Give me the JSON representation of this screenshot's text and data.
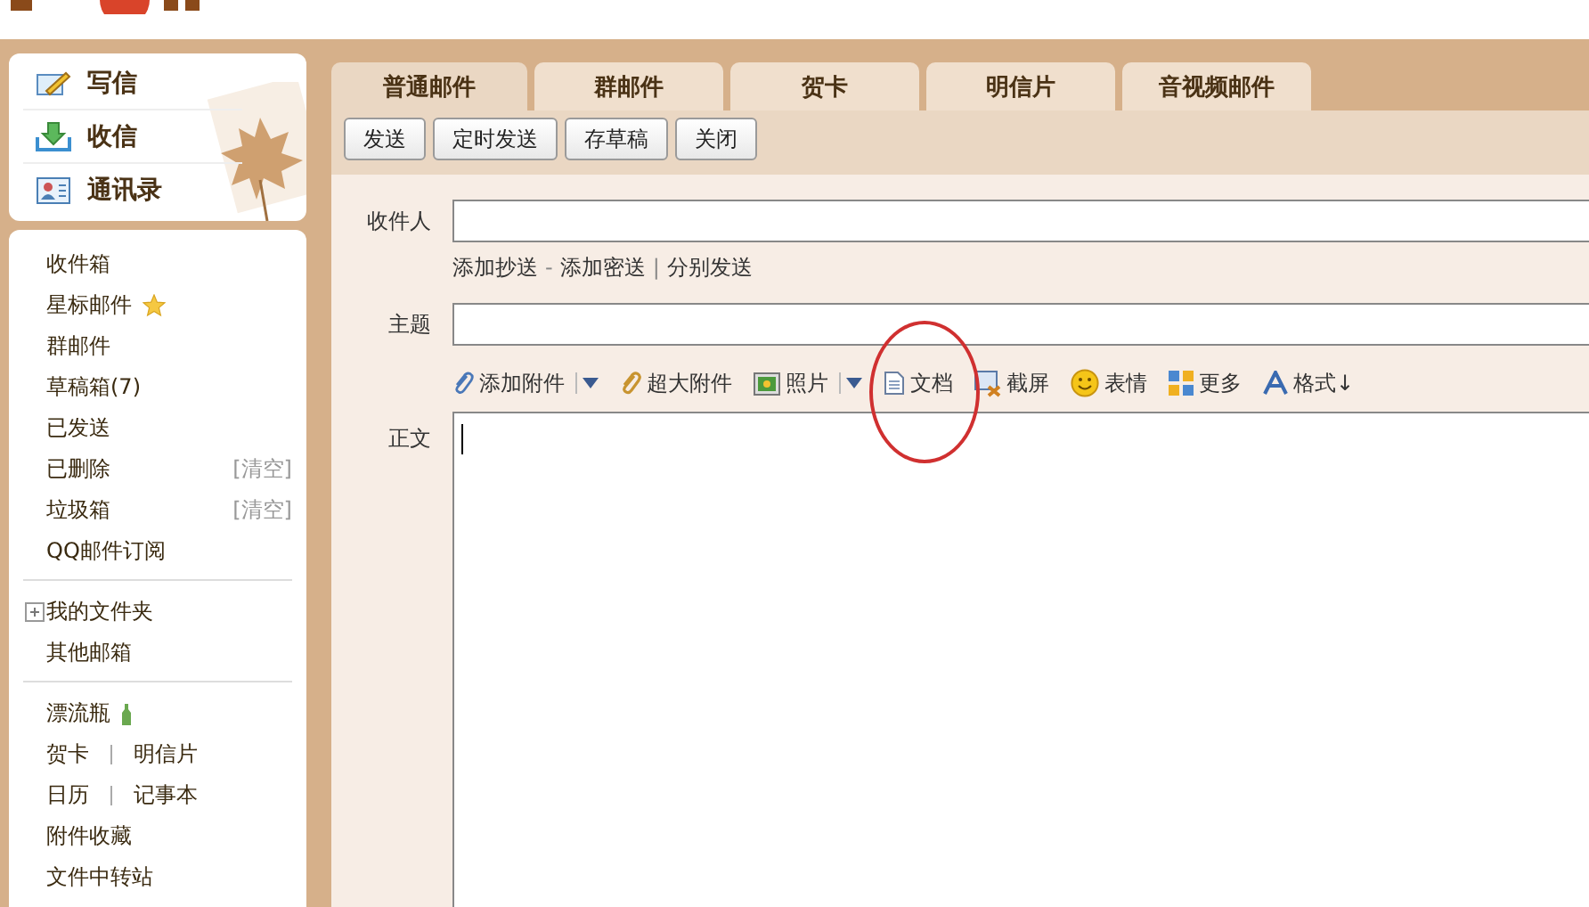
{
  "quick_actions": [
    {
      "kind": "pencil",
      "label": "写信"
    },
    {
      "kind": "inbox",
      "label": "收信"
    },
    {
      "kind": "contact",
      "label": "通讯录"
    }
  ],
  "folder_groups": [
    [
      {
        "kind": "plain",
        "label": "收件箱"
      },
      {
        "kind": "starred",
        "label": "星标邮件"
      },
      {
        "kind": "plain",
        "label": "群邮件"
      },
      {
        "kind": "plain",
        "label": "草稿箱(7)"
      },
      {
        "kind": "plain",
        "label": "已发送"
      },
      {
        "kind": "clear",
        "label": "已删除",
        "action": "[清空]"
      },
      {
        "kind": "clear",
        "label": "垃圾箱",
        "action": "[清空]"
      },
      {
        "kind": "plain",
        "label": "QQ邮件订阅"
      }
    ],
    [
      {
        "kind": "tree",
        "label": "我的文件夹",
        "expanded": false
      },
      {
        "kind": "plain",
        "label": "其他邮箱"
      }
    ],
    [
      {
        "kind": "bottle",
        "label": "漂流瓶"
      },
      {
        "kind": "pair",
        "labels": [
          "贺卡",
          "明信片"
        ]
      },
      {
        "kind": "pair",
        "labels": [
          "日历",
          "记事本"
        ]
      },
      {
        "kind": "plain",
        "label": "附件收藏"
      },
      {
        "kind": "plain",
        "label": "文件中转站"
      }
    ]
  ],
  "tabs": [
    {
      "label": "普通邮件",
      "selected": true
    },
    {
      "label": "群邮件",
      "selected": false
    },
    {
      "label": "贺卡",
      "selected": false
    },
    {
      "label": "明信片",
      "selected": false
    },
    {
      "label": "音视频邮件",
      "selected": false
    }
  ],
  "buttons": [
    "发送",
    "定时发送",
    "存草稿",
    "关闭"
  ],
  "recipient": {
    "label": "收件人",
    "links": [
      {
        "label": "添加抄送"
      },
      {
        "separator": "-",
        "label": "添加密送"
      },
      {
        "separator": "|",
        "label": "分别发送"
      }
    ]
  },
  "subject": {
    "label": "主题"
  },
  "attach_tools": [
    {
      "kind": "paperclip",
      "label": "添加附件",
      "dropdown": true
    },
    {
      "kind": "bigclip",
      "label": "超大附件",
      "dropdown": false
    },
    {
      "kind": "photo",
      "label": "照片",
      "dropdown": true
    },
    {
      "kind": "document",
      "label": "文档",
      "dropdown": false
    },
    {
      "kind": "screenshot",
      "label": "截屏",
      "dropdown": false
    },
    {
      "kind": "smiley",
      "label": "表情",
      "dropdown": false
    },
    {
      "kind": "grid",
      "label": "更多",
      "dropdown": false
    },
    {
      "kind": "font",
      "label": "格式↓",
      "dropdown": false
    }
  ],
  "body": {
    "label": "正文"
  }
}
